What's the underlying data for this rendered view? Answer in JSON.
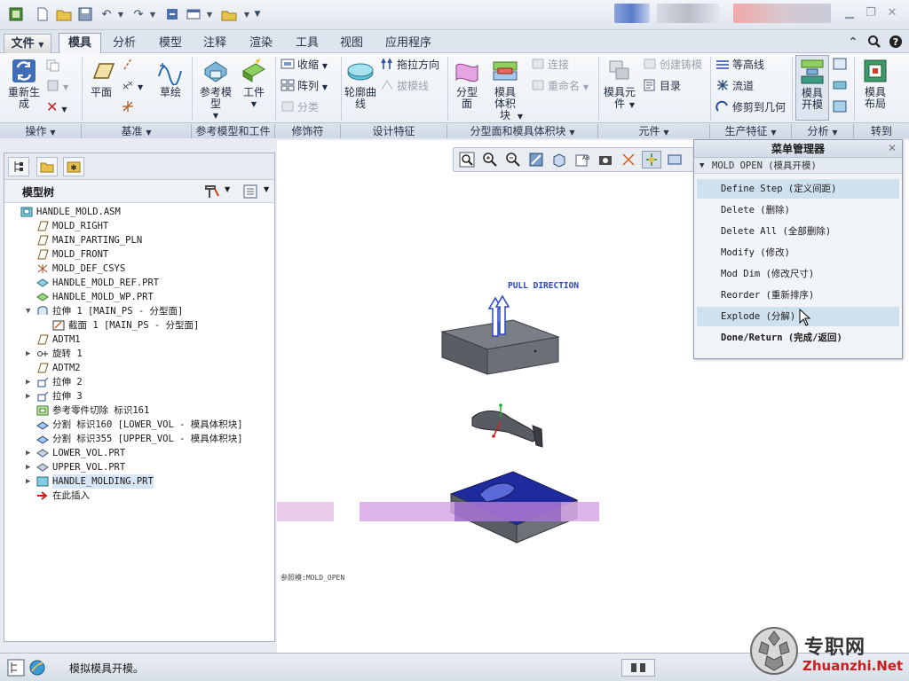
{
  "tabs": [
    {
      "label": "文件",
      "kind": "file"
    },
    {
      "label": "模具",
      "kind": "active"
    },
    {
      "label": "分析"
    },
    {
      "label": "模型"
    },
    {
      "label": "注释"
    },
    {
      "label": "渲染"
    },
    {
      "label": "工具"
    },
    {
      "label": "视图"
    },
    {
      "label": "应用程序"
    }
  ],
  "ribbon": {
    "regenerate": "重新生成",
    "plane": "平面",
    "sketch": "草绘",
    "ref_model": "参考模型",
    "workpiece": "工件",
    "shrink": "收缩",
    "array": "阵列",
    "classify": "分类",
    "contour_curve": "轮廓曲线",
    "pull_direction": "拖拉方向",
    "draft_line": "拔模线",
    "parting_surface": "分型面",
    "mold_volume": "模具体积块",
    "connect": "连接",
    "rename": "重命名",
    "mold_component": "模具元件",
    "create_casting": "创建铸模",
    "bom": "目录",
    "contour_line": "等高线",
    "flow": "流道",
    "trim_geometry": "修剪到几何",
    "mold_open": "模具开模",
    "mold_layout": "模具布局",
    "groups": [
      "操作",
      "基准",
      "参考模型和工件",
      "修饰符",
      "设计特征",
      "分型面和模具体积块",
      "元件",
      "生产特征",
      "分析",
      "转到"
    ]
  },
  "model_tree": {
    "title": "模型树",
    "items": [
      {
        "label": "HANDLE_MOLD.ASM",
        "depth": 0,
        "icon": "assembly-icon",
        "expand": ""
      },
      {
        "label": "MOLD_RIGHT",
        "depth": 1,
        "icon": "datum-plane-icon",
        "expand": ""
      },
      {
        "label": "MAIN_PARTING_PLN",
        "depth": 1,
        "icon": "datum-plane-icon",
        "expand": ""
      },
      {
        "label": "MOLD_FRONT",
        "depth": 1,
        "icon": "datum-plane-icon",
        "expand": ""
      },
      {
        "label": "MOLD_DEF_CSYS",
        "depth": 1,
        "icon": "csys-icon",
        "expand": ""
      },
      {
        "label": "HANDLE_MOLD_REF.PRT",
        "depth": 1,
        "icon": "ref-part-icon",
        "expand": ""
      },
      {
        "label": "HANDLE_MOLD_WP.PRT",
        "depth": 1,
        "icon": "workpiece-icon",
        "expand": ""
      },
      {
        "label": "拉伸 1 [MAIN_PS - 分型面]",
        "depth": 1,
        "icon": "extrude-surface-icon",
        "expand": "▼"
      },
      {
        "label": "截面 1 [MAIN_PS - 分型面]",
        "depth": 2,
        "icon": "section-icon",
        "expand": ""
      },
      {
        "label": "ADTM1",
        "depth": 1,
        "icon": "datum-plane-icon",
        "expand": ""
      },
      {
        "label": "旋转 1",
        "depth": 1,
        "icon": "revolve-icon",
        "expand": "▶"
      },
      {
        "label": "ADTM2",
        "depth": 1,
        "icon": "datum-plane-icon",
        "expand": ""
      },
      {
        "label": "拉伸 2",
        "depth": 1,
        "icon": "extrude-icon",
        "expand": "▶"
      },
      {
        "label": "拉伸 3",
        "depth": 1,
        "icon": "extrude-icon",
        "expand": "▶"
      },
      {
        "label": "参考零件切除 标识161",
        "depth": 1,
        "icon": "ref-cut-icon",
        "expand": ""
      },
      {
        "label": "分割 标识160 [LOWER_VOL - 模具体积块]",
        "depth": 1,
        "icon": "split-icon",
        "expand": ""
      },
      {
        "label": "分割 标识355 [UPPER_VOL - 模具体积块]",
        "depth": 1,
        "icon": "split-icon",
        "expand": ""
      },
      {
        "label": "LOWER_VOL.PRT",
        "depth": 1,
        "icon": "volume-part-icon",
        "expand": "▶"
      },
      {
        "label": "UPPER_VOL.PRT",
        "depth": 1,
        "icon": "volume-part-icon",
        "expand": "▶"
      },
      {
        "label": "HANDLE_MOLDING.PRT",
        "depth": 1,
        "icon": "molding-part-icon",
        "expand": "▶",
        "selected": true
      },
      {
        "label": "在此插入",
        "depth": 1,
        "icon": "insert-here-icon",
        "expand": ""
      }
    ]
  },
  "graphics": {
    "pull_direction_label": "PULL DIRECTION",
    "state_label": "参照模:MOLD_OPEN"
  },
  "menu_manager": {
    "title": "菜单管理器",
    "submenu": "MOLD OPEN (模具开模)",
    "items": [
      {
        "label": "Define Step (定义间距)",
        "highlight": true
      },
      {
        "label": "Delete (删除)"
      },
      {
        "label": "Delete All (全部删除)"
      },
      {
        "label": "Modify (修改)"
      },
      {
        "label": "Mod Dim (修改尺寸)"
      },
      {
        "label": "Reorder (重新排序)"
      },
      {
        "label": "Explode (分解)",
        "highlight": true
      },
      {
        "label": "Done/Return (完成/返回)",
        "bold": true
      }
    ]
  },
  "status": {
    "message": "模拟模具开模。"
  },
  "watermark": {
    "brand": "专职网",
    "url": "Zhuanzhi.Net"
  },
  "colors": {
    "selection": "#cfe1ef",
    "mold_blue": "#1f2a9c",
    "pull_arrow": "#2c46c8"
  }
}
